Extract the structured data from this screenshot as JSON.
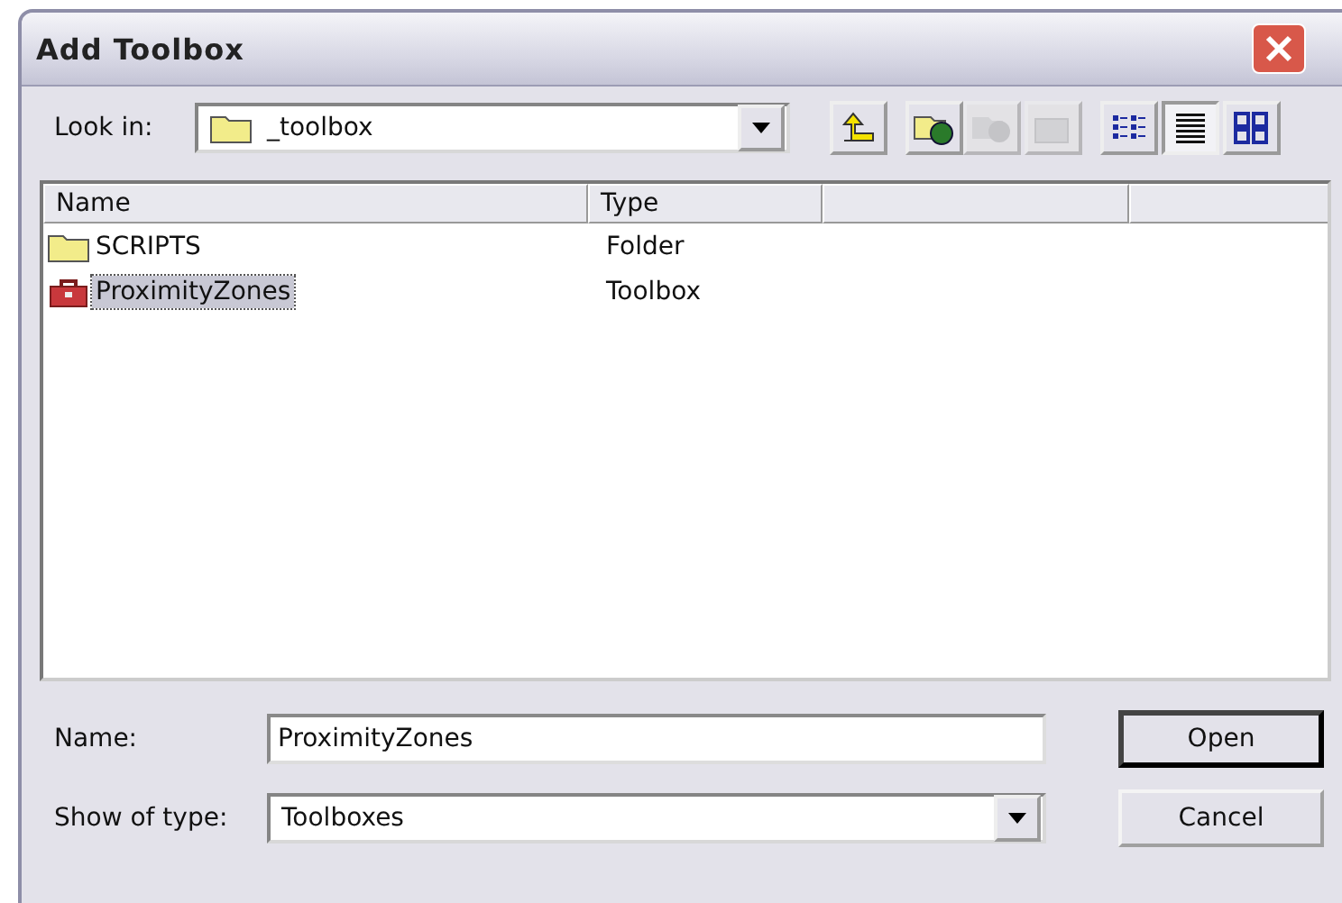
{
  "window": {
    "title": "Add Toolbox"
  },
  "look_in": {
    "label": "Look in:",
    "value": "_toolbox"
  },
  "toolbar": [
    {
      "kind": "up",
      "disabled": false,
      "pressed": false
    },
    {
      "kind": "connect",
      "disabled": false,
      "pressed": false
    },
    {
      "kind": "disconnect",
      "disabled": true,
      "pressed": false
    },
    {
      "kind": "properties",
      "disabled": true,
      "pressed": false
    },
    {
      "kind": "list",
      "disabled": false,
      "pressed": false
    },
    {
      "kind": "details",
      "disabled": false,
      "pressed": true
    },
    {
      "kind": "thumbnails",
      "disabled": false,
      "pressed": false
    }
  ],
  "table": {
    "columns": [
      "Name",
      "Type"
    ],
    "rows": [
      {
        "kind": "folder",
        "name": "SCRIPTS",
        "type": "Folder",
        "selected": false
      },
      {
        "kind": "toolbox",
        "name": "ProximityZones",
        "type": "Toolbox",
        "selected": true
      }
    ]
  },
  "name_field": {
    "label": "Name:",
    "value": "ProximityZones"
  },
  "type_field": {
    "label": "Show of type:",
    "value": "Toolboxes"
  },
  "buttons": [
    {
      "label": "Open",
      "default": true
    },
    {
      "label": "Cancel",
      "default": false
    }
  ]
}
